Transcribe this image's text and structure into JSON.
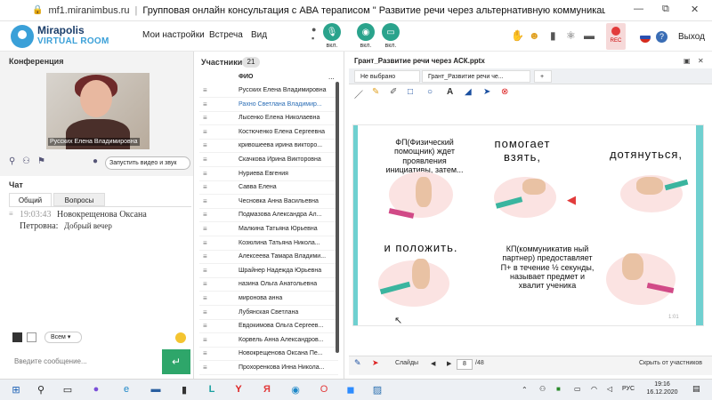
{
  "titlebar": {
    "url": "mf1.miranimbus.ru",
    "title": "Групповая онлайн консультация с АВА тераписом \" Развитие речи через альтернативную коммуникацию\"."
  },
  "header": {
    "logo_top": "Mirapolis",
    "logo_bottom": "VIRTUAL ROOM",
    "menu": [
      "Мои настройки",
      "Встреча",
      "Вид"
    ],
    "btn_labels": [
      "вкл.",
      "вкл.",
      "вкл."
    ],
    "rec_label": "REC",
    "help": "?",
    "exit": "Выход"
  },
  "conference": {
    "title": "Конференция",
    "video_caption": "Русских Елена Владимировна",
    "start_video": "Запустить видео и звук"
  },
  "chat": {
    "title": "Чат",
    "tabs": [
      "Общий",
      "Вопросы"
    ],
    "msg_time": "19:03:43",
    "msg_name_1": "Новокрещенова Оксана",
    "msg_name_2": "Петровна:",
    "msg_text": "Добрый вечер",
    "recipient": "Всем",
    "input_placeholder": "Введите сообщение...",
    "send_glyph": "↵"
  },
  "participants": {
    "title": "Участники",
    "count": "21",
    "column": "ФИО",
    "menu": "...",
    "rows": [
      "Русских Елена Владимировна",
      "Рахно Светлана Владимир...",
      "Лысенко Елена Николаевна",
      "Костюченко Елена Сергеевна",
      "кривошеева ирина викторо...",
      "Скачкова Ирина Викторовна",
      "Нуриева Евгения",
      "Савва Елена",
      "Чесновка Анна Васильевна",
      "Подмазова Александра Ал...",
      "Малкина Татьяна Юрьевна",
      "Козюлина Татьяна Никола...",
      "Алексеева Тамара Владими...",
      "Шрайнер Надежда Юрьевна",
      "назина Ольга Анатольевна",
      "миронова анна",
      "Лубянская Светлана",
      "Евдокимова Ольга Сергеев...",
      "Корвель Анна Александров...",
      "Новокрещенова Оксана Пе...",
      "Прохоренкова Инна Никола..."
    ]
  },
  "presentation": {
    "title": "Грант_Развитие речи через АСК.pptx",
    "tabs": [
      "Не выбрано",
      "Грант_Развитие речи че...",
      "+"
    ],
    "slide": {
      "t1": "ФП(Физический помощник) ждет проявления инициативы, затем...",
      "t2": "помогает взять,",
      "t3": "дотянуться,",
      "t4": "и положить.",
      "t5": "КП(коммуникатив ный партнер) предоставляет П+ в течение ½ секунды, называет предмет и хвалит ученика",
      "num": "1:01"
    },
    "slides_label": "Слайды",
    "page": "8",
    "total": "/48",
    "hide_label": "Скрыть от участников"
  },
  "taskbar": {
    "lang": "РУС",
    "time": "19:16",
    "date": "16.12.2020"
  },
  "colors": {
    "accent": "#2aa38c",
    "brand": "#1c3f6b",
    "rec": "#e23b3b",
    "send": "#2ea66a",
    "slide_rail": "#6fd0d0"
  }
}
